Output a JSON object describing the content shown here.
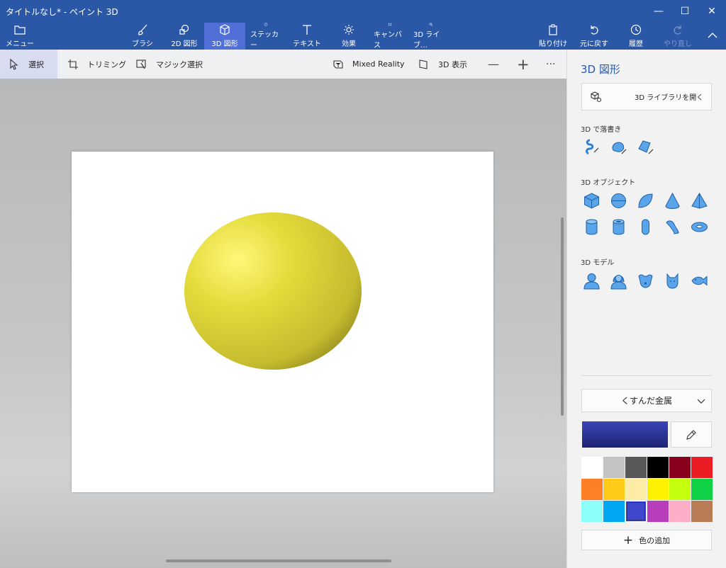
{
  "app": {
    "title": "タイトルなし* - ペイント 3D"
  },
  "window_controls": {
    "minimize": "—",
    "maximize": "☐",
    "close": "✕"
  },
  "ribbon": {
    "menu": "メニュー",
    "brush": "ブラシ",
    "shapes2d": "2D 図形",
    "shapes3d": "3D 図形",
    "stickers": "ステッカー",
    "text": "テキスト",
    "effects": "効果",
    "canvas": "キャンバス",
    "library": "3D ライブ…",
    "paste": "貼り付け",
    "undo": "元に戻す",
    "history": "履歴",
    "redo": "やり直し"
  },
  "toolbar": {
    "select": "選択",
    "crop": "トリミング",
    "magic_select": "マジック選択",
    "mixed_reality": "Mixed Reality",
    "view3d": "3D 表示",
    "zoom_out": "—",
    "zoom_in": "+",
    "more": "···"
  },
  "panel": {
    "title": "3D 図形",
    "open_library": "3D ライブラリを開く",
    "doodle_label": "3D で落書き",
    "objects_label": "3D オブジェクト",
    "models_label": "3D モデル",
    "material": "くすんだ金属",
    "add_color": "色の追加"
  },
  "colors": {
    "accent": "#2b58a6",
    "current": "#3a45b8",
    "palette": [
      "#ffffff",
      "#c3c3c3",
      "#585858",
      "#000000",
      "#88001b",
      "#ec1c24",
      "#ff7f27",
      "#ffca18",
      "#fdeca6",
      "#fff200",
      "#c4ff0e",
      "#0ed145",
      "#8cfffb",
      "#00a8f3",
      "#3f48cc",
      "#b83dba",
      "#ffaec8",
      "#b97a56"
    ],
    "selected_index": 14
  }
}
